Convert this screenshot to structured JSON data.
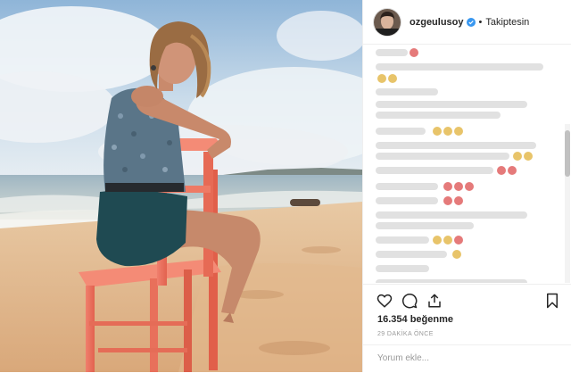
{
  "post": {
    "username": "ozgeulusoy",
    "follow_status": "Takiptesin",
    "likes": "16.354 beğenme",
    "time": "29 DAKİKA ÖNCE",
    "comment_placeholder": "Yorum ekle...",
    "verified_color": "#3897f0"
  },
  "icons": {
    "like": "heart-icon",
    "comment": "comment-icon",
    "share": "share-icon",
    "save": "bookmark-icon"
  }
}
